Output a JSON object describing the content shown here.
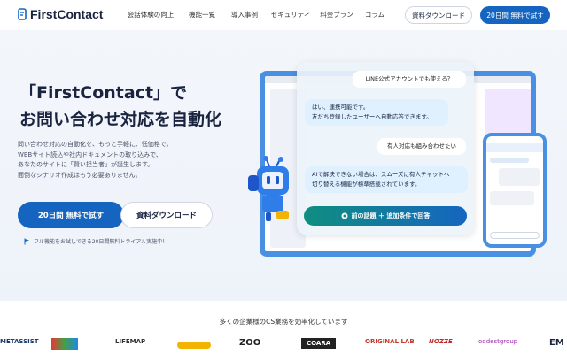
{
  "nav": {
    "logo_text": "FirstContact",
    "menu": [
      "会話体験の向上",
      "機能一覧",
      "導入事例",
      "セキュリティ",
      "料金プラン",
      "コラム"
    ],
    "doc_button": "資料ダウンロード",
    "trial_button": "20日間 無料で試す"
  },
  "hero": {
    "title_line1": "「FirstContact」で",
    "title_line2": "お問い合わせ対応を自動化",
    "desc": [
      "問い合わせ対応の自動化を、もっと手軽に、低価格で。",
      "WEBサイト読込や社内ドキュメントの取り込みで、",
      "あなたのサイトに「賢い担当者」が誕生します。",
      "面倒なシナリオ作成はもう必要ありません。"
    ],
    "cta_primary": "20日間 無料で試す",
    "cta_secondary": "資料ダウンロード",
    "note": "フル機能をお試しできる20日間無料トライアル実施中！"
  },
  "chat": {
    "user1": "LINE公式アカウントでも使える？",
    "bot1_line1": "はい、連携可能です。",
    "bot1_line2": "友だち登録したユーザーへ自動応答できます。",
    "user2": "有人対応も組み合わせたい",
    "bot2_line1": "AIで解決できない場合は、スムーズに有人チャットへ",
    "bot2_line2": "切り替える機能が標準搭載されています。",
    "next_button": "前の話題 ＋ 追加条件で回答"
  },
  "clients": {
    "title": "多くの企業様のCS業務を効率化しています",
    "logos": [
      "METASSIST",
      "",
      "LIFEMAP",
      "",
      "ZOO",
      "COARA",
      "ORIGINAL LAB",
      "NOZZE",
      "oddestgroup",
      "EM"
    ]
  },
  "colors": {
    "primary": "#1565c0",
    "accent": "#0f8e80",
    "text": "#1a2440"
  }
}
